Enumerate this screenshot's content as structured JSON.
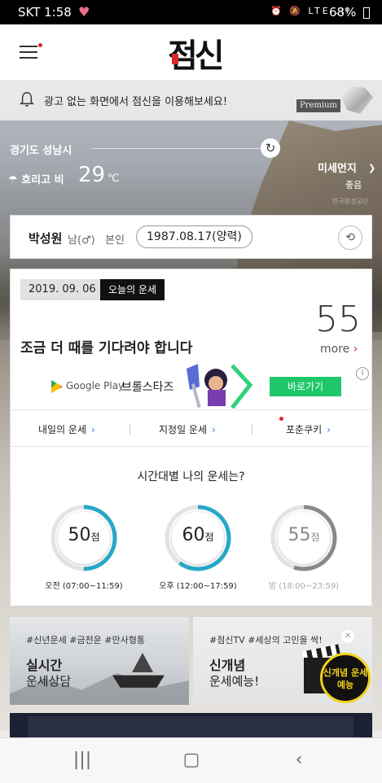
{
  "status_bar": {
    "carrier_time": "SKT 1:58",
    "icons": "⏰ 🔕 LTE .ıl",
    "battery": "68%"
  },
  "header": {
    "logo_text": "점신"
  },
  "ad_strip": {
    "text": "광고 없는 화면에서 점신을 이용해보세요!",
    "premium_label": "Premium"
  },
  "weather": {
    "location": "경기도 성남시",
    "condition": "흐리고 비",
    "temperature": "29",
    "unit": "℃",
    "dust_label": "미세먼지",
    "dust_value": "좋음",
    "dust_source": "한국환경공단"
  },
  "profile": {
    "name": "박성원",
    "gender": "남(♂)",
    "relation": "본인",
    "birth": "1987.08.17(양력)"
  },
  "fortune": {
    "date": "2019. 09. 06",
    "today_label": "오늘의 운세",
    "score": "55",
    "headline": "조금 더 때를 기다려야 합니다",
    "more_label": "more"
  },
  "ad": {
    "store": "Google Play",
    "game": "브롤스타즈",
    "button": "바로가기"
  },
  "links": [
    {
      "label": "내일의 운세"
    },
    {
      "label": "지정일 운세"
    },
    {
      "label": "포춘쿠키"
    }
  ],
  "time_section": {
    "title": "시간대별 나의 운세는?",
    "unit": "점",
    "gauges": [
      {
        "score": "50",
        "label": "오전 (07:00~11:59)",
        "fraction": 0.5,
        "color": "#28a8c8",
        "active": true
      },
      {
        "score": "60",
        "label": "오후 (12:00~17:59)",
        "fraction": 0.6,
        "color": "#28a8c8",
        "active": true
      },
      {
        "score": "55",
        "label": "밤 (18:00~23:59)",
        "fraction": 0.55,
        "color": "#8a8a8a",
        "active": false
      }
    ]
  },
  "tiles": [
    {
      "tags": "#신년운세 #금전운 #만사형통",
      "line1": "실시간",
      "line2": "운세상담"
    },
    {
      "tags": "#점신TV #세상의 고민을 싹!",
      "line1": "신개념",
      "line2": "운세예능!",
      "badge": "신개념 운세예능"
    }
  ],
  "colors": {
    "accent_red": "#d9262c",
    "ad_green": "#1ec86a",
    "gauge_blue": "#28a8c8"
  }
}
